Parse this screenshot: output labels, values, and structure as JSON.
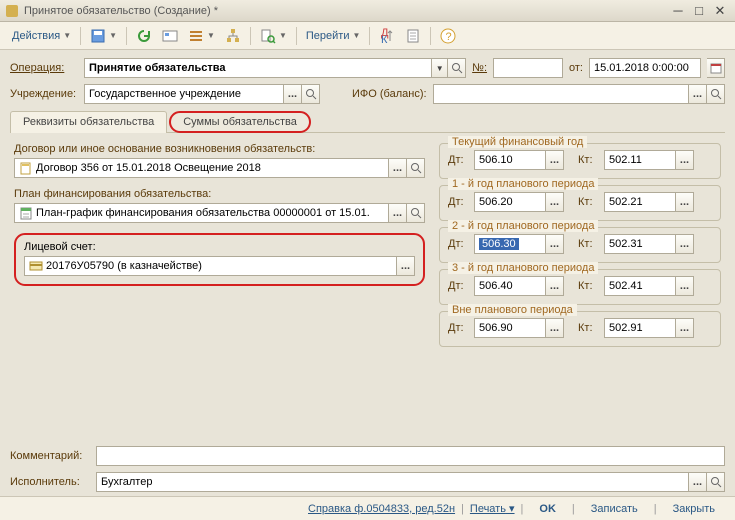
{
  "window": {
    "title": "Принятое обязательство (Создание) *"
  },
  "toolbar": {
    "actions": "Действия",
    "goto": "Перейти"
  },
  "op": {
    "label": "Операция:",
    "value": "Принятие обязательства",
    "numLabel": "№:",
    "fromLabel": "от:",
    "date": "15.01.2018 0:00:00"
  },
  "inst": {
    "label": "Учреждение:",
    "value": "Государственное учреждение",
    "ifoLabel": "ИФО (баланс):",
    "ifoValue": ""
  },
  "tabs": {
    "t1": "Реквизиты обязательства",
    "t2": "Суммы обязательства"
  },
  "contract": {
    "label": "Договор или иное основание возникновения обязательств:",
    "value": "Договор 356 от 15.01.2018 Освещение 2018"
  },
  "plan": {
    "label": "План финансирования обязательства:",
    "value": "План-график финансирования обязательства 00000001 от 15.01."
  },
  "account": {
    "label": "Лицевой счет:",
    "value": "20176У05790 (в казначействе)"
  },
  "fy": {
    "current": {
      "title": "Текущий финансовый год",
      "dt": "506.10",
      "kt": "502.11"
    },
    "y1": {
      "title": "1 - й год планового периода",
      "dt": "506.20",
      "kt": "502.21"
    },
    "y2": {
      "title": "2 - й год планового периода",
      "dt": "506.30",
      "kt": "502.31"
    },
    "y3": {
      "title": "3 - й год планового периода",
      "dt": "506.40",
      "kt": "502.41"
    },
    "out": {
      "title": "Вне планового периода",
      "dt": "506.90",
      "kt": "502.91"
    }
  },
  "acct": {
    "dtLabel": "Дт:",
    "ktLabel": "Кт:"
  },
  "bottom": {
    "comment": "Комментарий:",
    "executor": "Исполнитель:",
    "executorVal": "Бухгалтер"
  },
  "footer": {
    "ref": "Справка ф.0504833, ред.52н",
    "print": "Печать",
    "ok": "OK",
    "save": "Записать",
    "close": "Закрыть"
  }
}
